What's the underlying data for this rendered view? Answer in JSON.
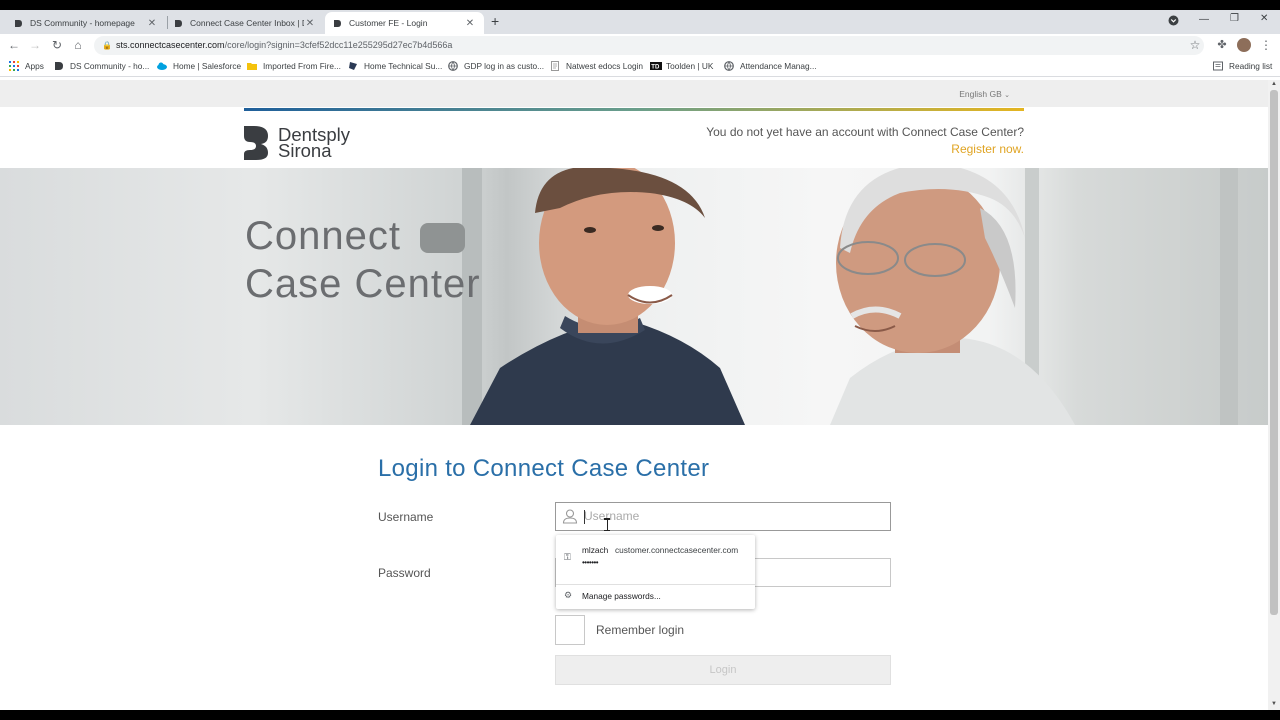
{
  "browser": {
    "tabs": [
      {
        "title": "DS Community - homepage",
        "active": false
      },
      {
        "title": "Connect Case Center Inbox | Den",
        "active": false
      },
      {
        "title": "Customer FE - Login",
        "active": true
      }
    ],
    "new_tab": "+",
    "url_host": "sts.connectcasecenter.com",
    "url_path": "/core/login?signin=3cfef52dcc11e255295d27ec7b4d566a",
    "bookmarks": [
      {
        "label": "Apps",
        "icon": "apps-grid-icon"
      },
      {
        "label": "DS Community - ho...",
        "icon": "dentsply-icon"
      },
      {
        "label": "Home | Salesforce",
        "icon": "salesforce-cloud-icon"
      },
      {
        "label": "Imported From Fire...",
        "icon": "folder-icon"
      },
      {
        "label": "Home Technical Su...",
        "icon": "support-icon"
      },
      {
        "label": "GDP log in as custo...",
        "icon": "globe-icon"
      },
      {
        "label": "Natwest edocs Login",
        "icon": "page-icon"
      },
      {
        "label": "Toolden | UK",
        "icon": "toolden-icon"
      },
      {
        "label": "Attendance Manag...",
        "icon": "globe-icon"
      }
    ],
    "reading_list": "Reading list"
  },
  "page": {
    "language": "English GB",
    "brand_line1": "Dentsply",
    "brand_line2": "Sirona",
    "account_prompt": "You do not yet have an account with Connect Case Center?",
    "register_link": "Register now.",
    "hero_line1": "Connect",
    "hero_line2": "Case Center",
    "login_title": "Login to Connect Case Center",
    "username_label": "Username",
    "username_placeholder": "Username",
    "password_label": "Password",
    "remember_label": "Remember login",
    "login_button": "Login"
  },
  "autofill": {
    "username": "mlzach",
    "site": "customer.connectcasecenter.com",
    "password_mask": "•••••••",
    "manage": "Manage passwords..."
  },
  "colors": {
    "title_blue": "#2a6fa8",
    "register_orange": "#e0a423"
  }
}
